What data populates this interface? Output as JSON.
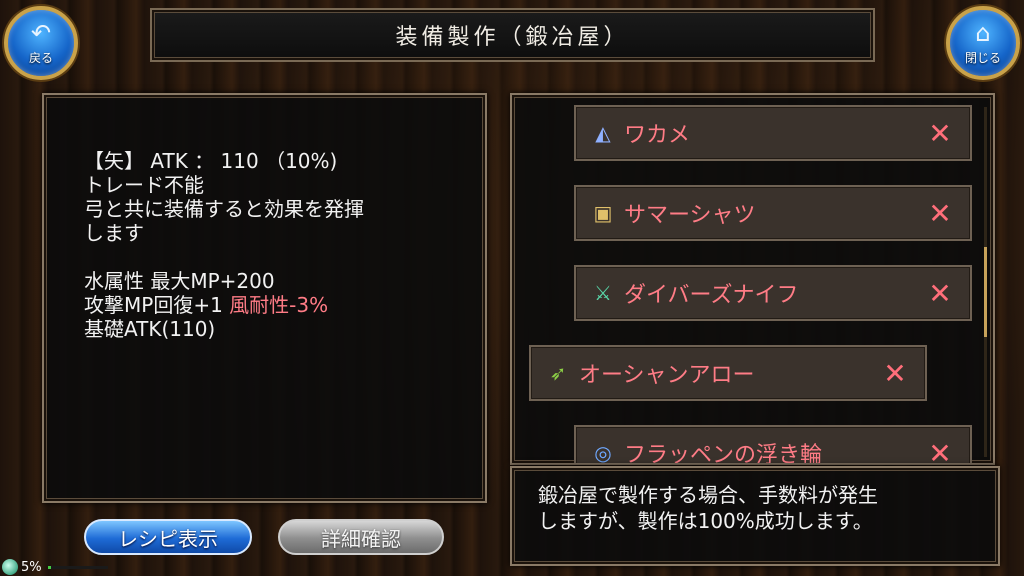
{
  "header": {
    "title": "装備製作（鍛冶屋）"
  },
  "nav": {
    "back_label": "戻る",
    "close_label": "閉じる"
  },
  "description": {
    "line1": "【矢】 ATK ： 110 （10%)",
    "line2": "トレード不能",
    "line3": "弓と共に装備すると効果を発揮",
    "line4": "します",
    "line5": "水属性 最大MP+200",
    "line6a": "攻撃MP回復+1 ",
    "line6b": "風耐性-3%",
    "line7": "基礎ATK(110)"
  },
  "recipe_list": {
    "items": [
      {
        "icon": "hat-icon",
        "label": "ワカメ",
        "mark": "✕"
      },
      {
        "icon": "shirt-icon",
        "label": "サマーシャツ",
        "mark": "✕"
      },
      {
        "icon": "knife-icon",
        "label": "ダイバーズナイフ",
        "mark": "✕"
      },
      {
        "icon": "arrow-icon",
        "label": "オーシャンアロー",
        "mark": "✕"
      },
      {
        "icon": "float-ring-icon",
        "label": "フラッペンの浮き輪",
        "mark": "✕"
      }
    ]
  },
  "info": {
    "line1": "鍛冶屋で製作する場合、手数料が発生",
    "line2": "しますが、製作は100%成功します。"
  },
  "buttons": {
    "recipe_label": "レシピ表示",
    "detail_label": "詳細確認"
  },
  "status": {
    "progress_text": "5%",
    "progress_fraction": 0.05
  },
  "colors": {
    "accent_red": "#ff7c86",
    "button_blue": "#1e6bd6",
    "frame_gold": "#c9a24a"
  }
}
